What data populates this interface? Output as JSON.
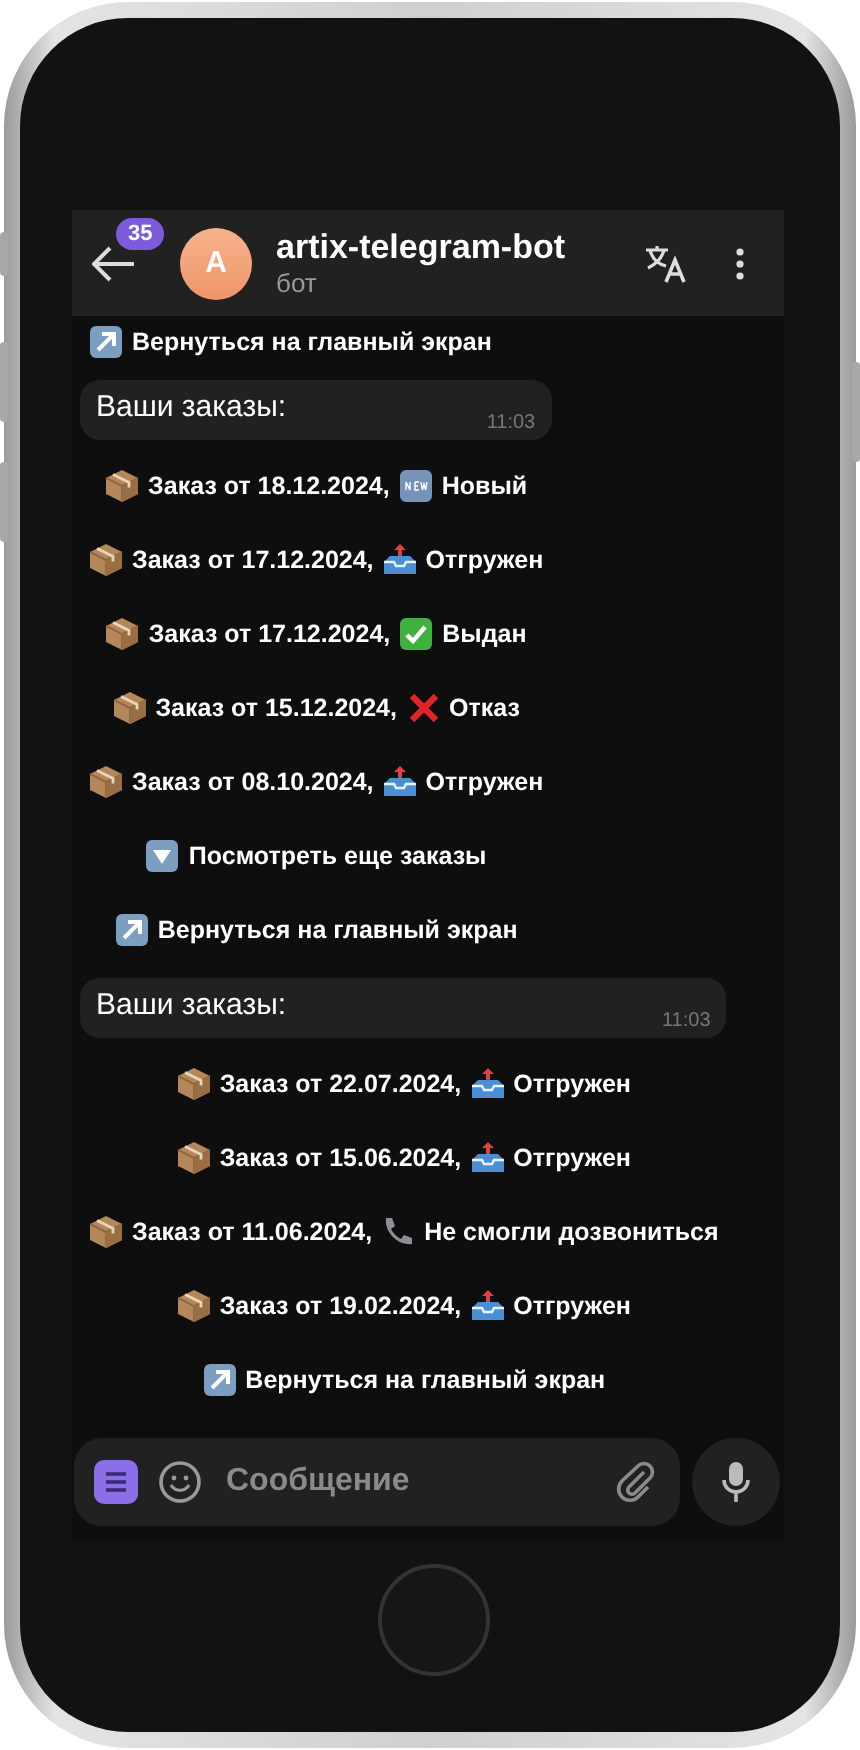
{
  "header": {
    "unread_count": "35",
    "avatar_letter": "A",
    "title": "artix-telegram-bot",
    "subtitle": "бот"
  },
  "messages": [
    {
      "buttons": [
        {
          "kind": "home",
          "label": "Вернуться на главный экран"
        }
      ]
    },
    {
      "text": "Ваши заказы:",
      "time": "11:03",
      "buttons": [
        {
          "kind": "order",
          "label": "Заказ от 18.12.2024,",
          "status": {
            "kind": "new",
            "text": "Новый"
          }
        },
        {
          "kind": "order",
          "label": "Заказ от 17.12.2024,",
          "status": {
            "kind": "shipped",
            "text": "Отгружен"
          }
        },
        {
          "kind": "order",
          "label": "Заказ от 17.12.2024,",
          "status": {
            "kind": "issued",
            "text": "Выдан"
          }
        },
        {
          "kind": "order",
          "label": "Заказ от 15.12.2024,",
          "status": {
            "kind": "refused",
            "text": "Отказ"
          }
        },
        {
          "kind": "order",
          "label": "Заказ от 08.10.2024,",
          "status": {
            "kind": "shipped",
            "text": "Отгружен"
          }
        },
        {
          "kind": "more",
          "label": "Посмотреть еще заказы"
        },
        {
          "kind": "home",
          "label": "Вернуться на главный экран"
        }
      ]
    },
    {
      "text": "Ваши заказы:",
      "time": "11:03",
      "buttons": [
        {
          "kind": "order",
          "label": "Заказ от 22.07.2024,",
          "status": {
            "kind": "shipped",
            "text": "Отгружен"
          }
        },
        {
          "kind": "order",
          "label": "Заказ от 15.06.2024,",
          "status": {
            "kind": "shipped",
            "text": "Отгружен"
          }
        },
        {
          "kind": "order",
          "label": "Заказ от 11.06.2024,",
          "status": {
            "kind": "call_failed",
            "text": "Не смогли дозвониться"
          }
        },
        {
          "kind": "order",
          "label": "Заказ от 19.02.2024,",
          "status": {
            "kind": "shipped",
            "text": "Отгружен"
          }
        },
        {
          "kind": "home",
          "label": "Вернуться на главный экран"
        }
      ]
    }
  ],
  "composer": {
    "placeholder": "Сообщение"
  }
}
